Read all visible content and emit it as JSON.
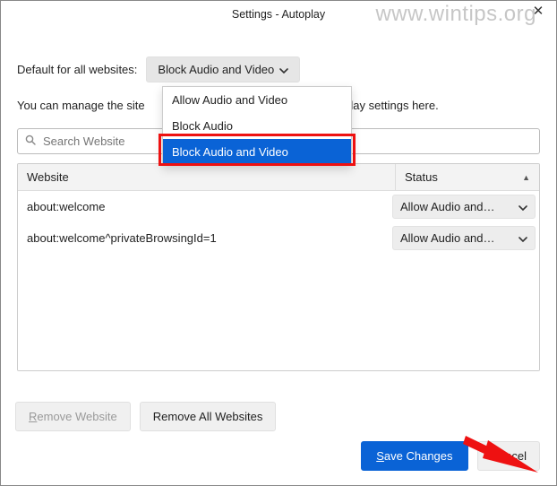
{
  "window": {
    "title": "Settings - Autoplay",
    "watermark": "www.wintips.org"
  },
  "labels": {
    "default_for": "Default for all websites:",
    "manage_line_before": "You can manage the site",
    "manage_line_after": " autoplay settings here."
  },
  "default_dropdown": {
    "selected": "Block Audio and Video",
    "options": [
      "Allow Audio and Video",
      "Block Audio",
      "Block Audio and Video"
    ],
    "highlighted_index": 2
  },
  "search": {
    "placeholder": "Search Website"
  },
  "table": {
    "headers": {
      "website": "Website",
      "status": "Status"
    },
    "rows": [
      {
        "website": "about:welcome",
        "status": "Allow Audio and…"
      },
      {
        "website": "about:welcome^privateBrowsingId=1",
        "status": "Allow Audio and…"
      }
    ]
  },
  "buttons": {
    "remove_website": "Remove Website",
    "remove_all": "Remove All Websites",
    "save": "Save Changes",
    "cancel": "Cancel"
  }
}
